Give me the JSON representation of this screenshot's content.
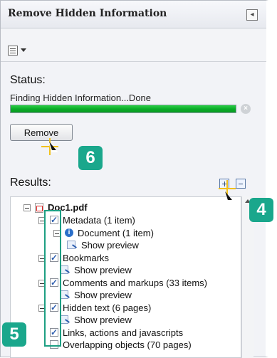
{
  "panel": {
    "title": "Remove Hidden Information",
    "collapse_icon": "collapse-panel-icon"
  },
  "toolbar": {
    "options_icon": "options-menu-icon"
  },
  "status": {
    "label": "Status:",
    "progress_text": "Finding Hidden Information...Done",
    "progress_value": 1.0
  },
  "actions": {
    "remove_label": "Remove"
  },
  "results": {
    "label": "Results:",
    "items": [
      {
        "label": "Doc1.pdf"
      },
      {
        "label": "Metadata (1 item)"
      },
      {
        "label": "Document (1 item)"
      },
      {
        "label": "Show preview"
      },
      {
        "label": "Bookmarks"
      },
      {
        "label": "Show preview"
      },
      {
        "label": "Comments and markups (33 items)"
      },
      {
        "label": "Show preview"
      },
      {
        "label": "Hidden text (6 pages)"
      },
      {
        "label": "Show preview"
      },
      {
        "label": "Links, actions and javascripts"
      },
      {
        "label": "Overlapping objects (70 pages)"
      }
    ]
  },
  "annotations": {
    "step6": "6",
    "step4": "4",
    "step5": "5",
    "accent": "#1aa78c"
  }
}
